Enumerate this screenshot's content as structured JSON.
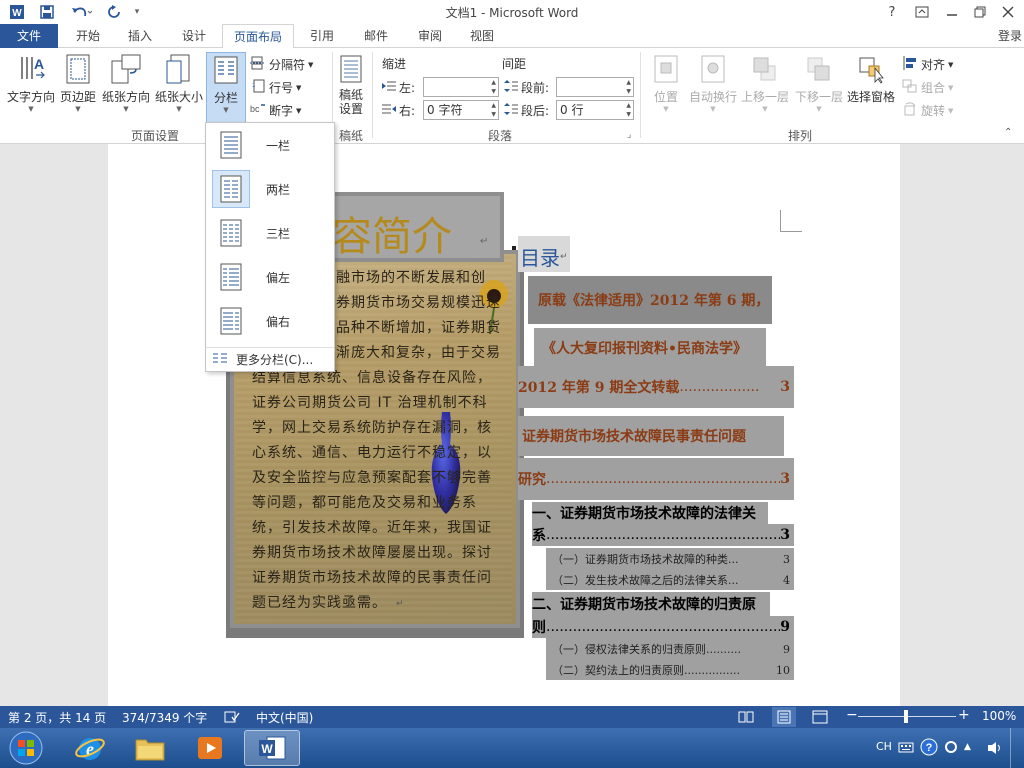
{
  "window": {
    "title": "文档1 - Microsoft Word",
    "help": "?",
    "controls": [
      "restore-ribbon",
      "minimize",
      "maximize",
      "close"
    ]
  },
  "qat": {
    "more": "▾"
  },
  "tabs": [
    "文件",
    "开始",
    "插入",
    "设计",
    "页面布局",
    "引用",
    "邮件",
    "审阅",
    "视图"
  ],
  "active_tab": "页面布局",
  "login": "登录",
  "ribbon": {
    "page_setup": {
      "label": "页面设置",
      "text_direction": "文字方向",
      "margins": "页边距",
      "orientation": "纸张方向",
      "size": "纸张大小",
      "columns": "分栏",
      "breaks": "分隔符",
      "line_numbers": "行号",
      "hyphenation": "断字"
    },
    "draft_paper": {
      "label": "稿纸",
      "button_line1": "稿纸",
      "button_line2": "设置"
    },
    "paragraph": {
      "label": "段落",
      "indent_label": "缩进",
      "spacing_label": "间距",
      "left_label": "左:",
      "right_label": "右:",
      "right_value": "0 字符",
      "before_label": "段前:",
      "after_label": "段后:",
      "after_value": "0 行"
    },
    "arrange": {
      "label": "排列",
      "position": "位置",
      "wrap": "自动换行",
      "bring_forward": "上移一层",
      "send_backward": "下移一层",
      "selection_pane": "选择窗格",
      "align": "对齐",
      "group": "组合",
      "rotate": "旋转"
    }
  },
  "columns_menu": {
    "items": [
      "一栏",
      "两栏",
      "三栏",
      "偏左",
      "偏右"
    ],
    "selected": "两栏",
    "more": "更多分栏(C)..."
  },
  "document": {
    "heading": "容简介",
    "para_lines": [
      "融市场的不断发展和创",
      "券期货市场交易规模迅速",
      "品种不断增加，证券期货",
      "渐庞大和复杂，由于交易",
      "结算信息系统、信息设备存在风险，",
      "证券公司期货公司 IT 治理机制不科",
      "学，网上交易系统防护存在漏洞，核",
      "心系统、通信、电力运行不稳定，以",
      "及安全监控与应急预案配套不够完善",
      "等问题，都可能危及交易和业务系",
      "统，引发技术故障。近年来，我国证",
      "券期货市场技术故障屡屡出现。探讨",
      "证券期货市场技术故障的民事责任问",
      "题已经为实践亟需。"
    ],
    "toc_title": "目录",
    "toc": [
      {
        "text": "原载《法律适用》2012 年第 6 期，",
        "page": ""
      },
      {
        "text": "《人大复印报刊资料•民商法学》",
        "page": ""
      },
      {
        "text": "2012 年第 9 期全文转载",
        "dots": "..................",
        "page": "3"
      },
      {
        "text": "证券期货市场技术故障民事责任问题",
        "page": ""
      },
      {
        "text": "研究",
        "dots": "......................................................",
        "page": "3"
      },
      {
        "text": "一、证券期货市场技术故障的法律关",
        "page": ""
      },
      {
        "text": "系",
        "dots": "..........................................................",
        "page": "3"
      },
      {
        "text": "（一）证券期货市场技术故障的种类",
        "dots": "...",
        "page": "3"
      },
      {
        "text": "（二）发生技术故障之后的法律关系",
        "dots": "...",
        "page": "4"
      },
      {
        "text": "二、证券期货市场技术故障的归责原",
        "page": ""
      },
      {
        "text": "则",
        "dots": "..........................................................",
        "page": "9"
      },
      {
        "text": "（一）侵权法律关系的归责原则",
        "dots": "..........",
        "page": "9"
      },
      {
        "text": "（二）契约法上的归责原则",
        "dots": "................",
        "page": "10"
      }
    ]
  },
  "status": {
    "page": "第 2 页，共 14 页",
    "words": "374/7349 个字",
    "language": "中文(中国)",
    "zoom": "100%",
    "zoom_minus": "−",
    "zoom_plus": "+"
  },
  "taskbar": {
    "tray_lang": "CH",
    "word_icon_letter": "W",
    "ie_letter": "e"
  },
  "colors": {
    "accent": "#2b579a",
    "toc_red": "#8b3c14",
    "heading_gold": "#b58a1c"
  }
}
